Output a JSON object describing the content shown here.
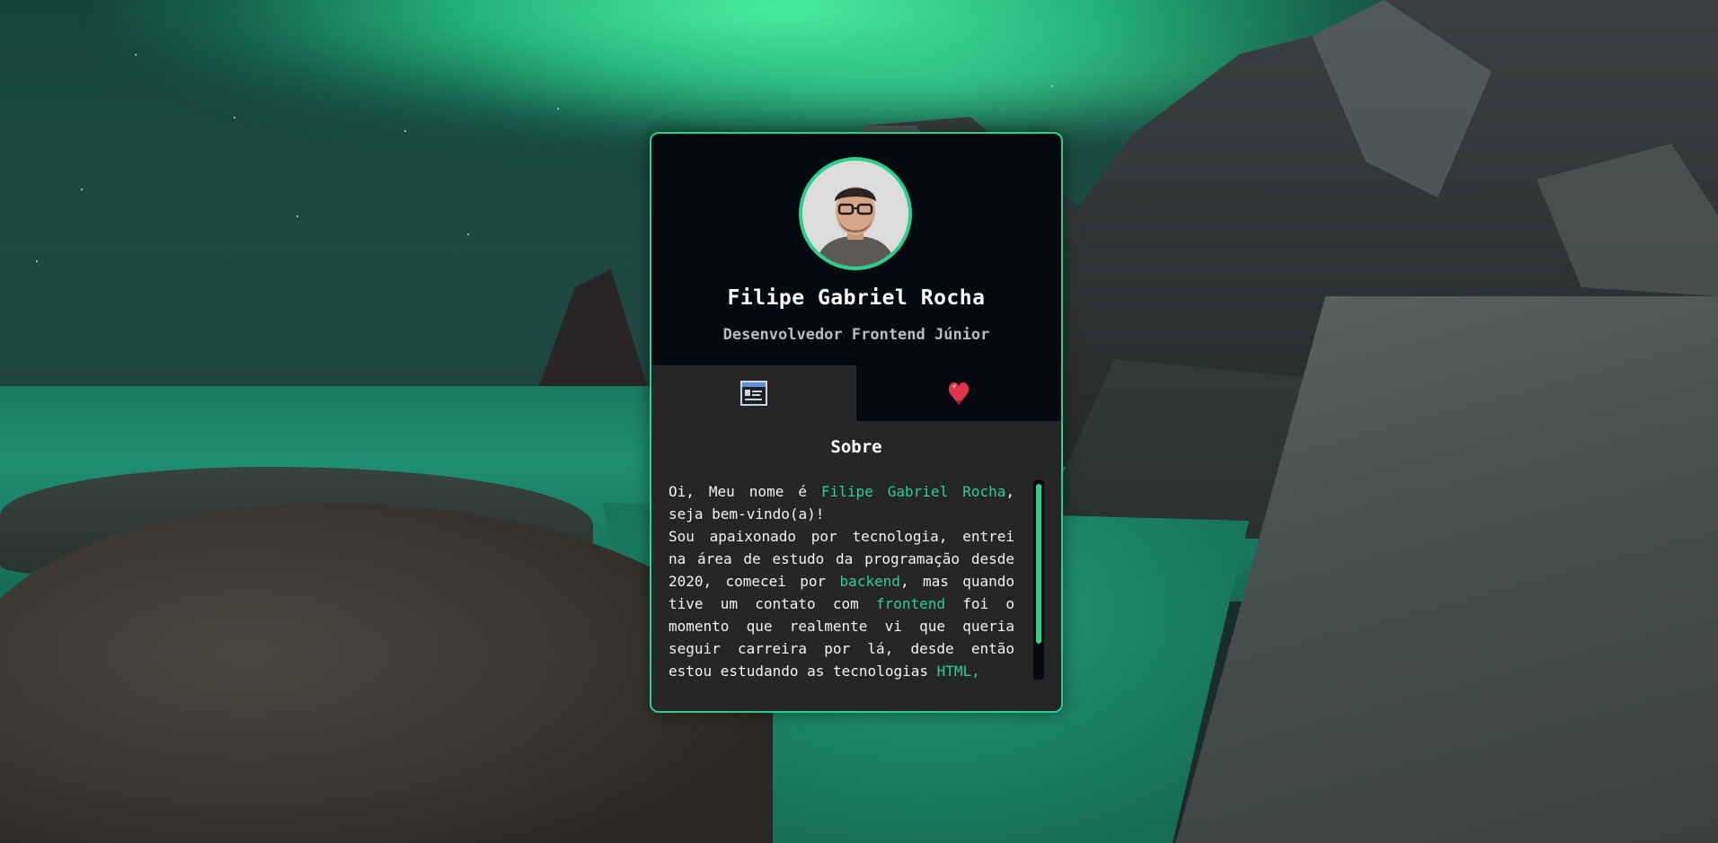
{
  "theme": {
    "accent": "#2ad18e",
    "card_bg": "#050a10",
    "panel_bg": "#262628"
  },
  "profile": {
    "avatar_icon": "avatar-photo",
    "name": "Filipe Gabriel Rocha",
    "role": "Desenvolvedor Frontend Júnior"
  },
  "tabs": [
    {
      "icon": "profile-card-icon",
      "active": true
    },
    {
      "icon": "heart-icon",
      "active": false
    }
  ],
  "about": {
    "title": "Sobre",
    "p1_a": "Oi, Meu nome é ",
    "p1_name": "Filipe Gabriel Rocha",
    "p1_b": ", seja bem-vindo(a)!",
    "p2_a": "Sou apaixonado por tecnologia, entrei na área de estudo da programação desde 2020, comecei por ",
    "p2_backend": "backend",
    "p2_b": ", mas quando tive um contato com ",
    "p2_frontend": "frontend",
    "p2_c": " foi o momento que realmente vi que queria seguir carreira por lá, desde então estou estudando as tecnologias ",
    "p2_html": "HTML,"
  }
}
